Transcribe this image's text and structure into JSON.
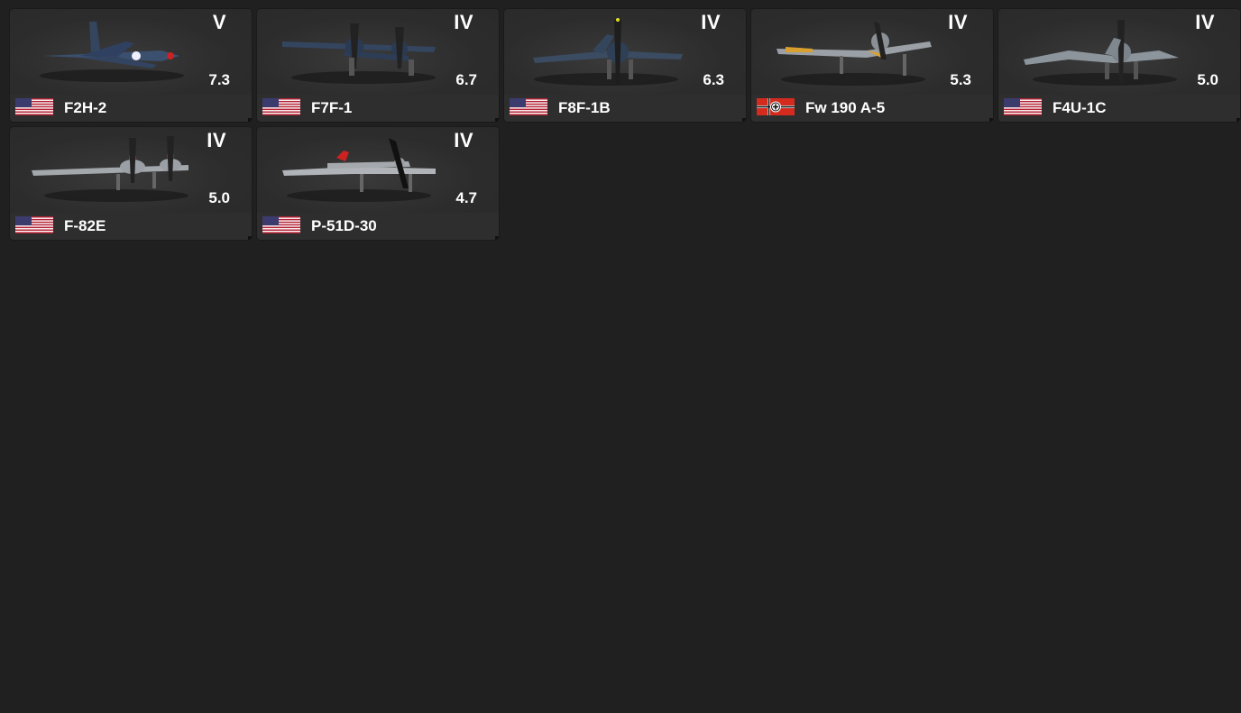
{
  "vehicles": [
    {
      "name": "F2H-2",
      "rank": "V",
      "br": "7.3",
      "nation": "usa-flag-icon",
      "plane": "jet-fighter-icon",
      "color": "#3b4f6e"
    },
    {
      "name": "F7F-1",
      "rank": "IV",
      "br": "6.7",
      "nation": "usa-flag-icon",
      "plane": "twin-engine-fighter-icon",
      "color": "#34455f"
    },
    {
      "name": "F8F-1B",
      "rank": "IV",
      "br": "6.3",
      "nation": "usa-flag-icon",
      "plane": "prop-fighter-icon",
      "color": "#3a4b62"
    },
    {
      "name": "Fw 190 A-5",
      "rank": "IV",
      "br": "5.3",
      "nation": "germany-war-ensign-flag-icon",
      "plane": "prop-fighter-icon",
      "color": "#9aa0a6"
    },
    {
      "name": "F4U-1C",
      "rank": "IV",
      "br": "5.0",
      "nation": "usa-flag-icon",
      "plane": "gull-wing-fighter-icon",
      "color": "#8c949c"
    },
    {
      "name": "F-82E",
      "rank": "IV",
      "br": "5.0",
      "nation": "usa-flag-icon",
      "plane": "twin-mustang-icon",
      "color": "#a3a8ad"
    },
    {
      "name": "P-51D-30",
      "rank": "IV",
      "br": "4.7",
      "nation": "usa-flag-icon",
      "plane": "prop-fighter-icon",
      "color": "#b0b4b8"
    }
  ]
}
